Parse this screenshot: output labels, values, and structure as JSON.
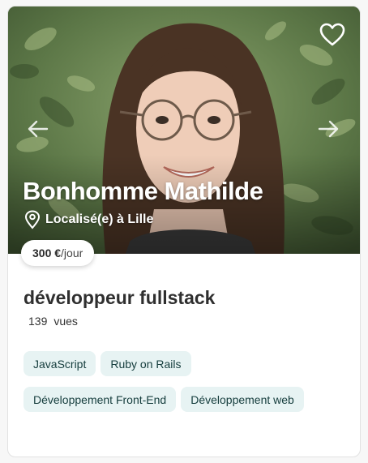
{
  "profile": {
    "name": "Bonhomme Mathilde",
    "location": "Localisé(e) à Lille",
    "price_amount": "300 €",
    "price_unit": "/jour",
    "title": "développeur fullstack",
    "views_count": "139",
    "views_label": "vues"
  },
  "tags": [
    "JavaScript",
    "Ruby on Rails",
    "Développement Front-End",
    "Développement web"
  ],
  "icons": {
    "favorite": "heart-outline-icon",
    "previous": "arrow-left-icon",
    "next": "arrow-right-icon",
    "location": "map-pin-icon"
  },
  "colors": {
    "tag_background": "#e7f3f3",
    "tag_text": "#153d3d",
    "text_dark": "#2f2f2f"
  }
}
